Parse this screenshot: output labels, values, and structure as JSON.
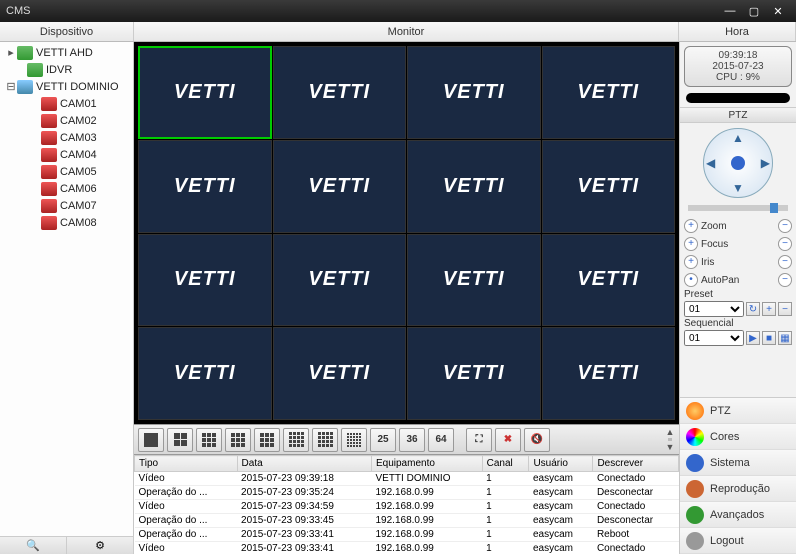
{
  "app_title": "CMS",
  "header": {
    "device": "Dispositivo",
    "monitor": "Monitor",
    "time": "Hora"
  },
  "clock": {
    "time": "09:39:18",
    "date": "2015-07-23",
    "cpu": "CPU : 9%"
  },
  "tree": {
    "root": "VETTI AHD",
    "idvr": "IDVR",
    "domain": "VETTI DOMINIO",
    "cams": [
      "CAM01",
      "CAM02",
      "CAM03",
      "CAM04",
      "CAM05",
      "CAM06",
      "CAM07",
      "CAM08"
    ]
  },
  "grid_brand": "VETTI",
  "view_buttons_numeric": [
    "25",
    "36",
    "64"
  ],
  "ptz": {
    "title": "PTZ",
    "zoom": "Zoom",
    "focus": "Focus",
    "iris": "Iris",
    "autopan": "AutoPan",
    "preset_label": "Preset",
    "sequential_label": "Sequencial",
    "preset_value": "01",
    "sequential_value": "01"
  },
  "side_tabs": {
    "ptz": "PTZ",
    "cores": "Cores",
    "sistema": "Sistema",
    "reproducao": "Reprodução",
    "avancados": "Avançados",
    "logout": "Logout"
  },
  "log": {
    "headers": {
      "tipo": "Tipo",
      "data": "Data",
      "equipamento": "Equipamento",
      "canal": "Canal",
      "usuario": "Usuário",
      "descrever": "Descrever"
    },
    "rows": [
      {
        "tipo": "Vídeo",
        "data": "2015-07-23 09:39:18",
        "equip": "VETTI DOMINIO",
        "canal": "1",
        "user": "easycam",
        "desc": "Conectado"
      },
      {
        "tipo": "Operação do ...",
        "data": "2015-07-23 09:35:24",
        "equip": "192.168.0.99",
        "canal": "1",
        "user": "easycam",
        "desc": "Desconectar"
      },
      {
        "tipo": "Vídeo",
        "data": "2015-07-23 09:34:59",
        "equip": "192.168.0.99",
        "canal": "1",
        "user": "easycam",
        "desc": "Conectado"
      },
      {
        "tipo": "Operação do ...",
        "data": "2015-07-23 09:33:45",
        "equip": "192.168.0.99",
        "canal": "1",
        "user": "easycam",
        "desc": "Desconectar"
      },
      {
        "tipo": "Operação do ...",
        "data": "2015-07-23 09:33:41",
        "equip": "192.168.0.99",
        "canal": "1",
        "user": "easycam",
        "desc": "Reboot"
      },
      {
        "tipo": "Vídeo",
        "data": "2015-07-23 09:33:41",
        "equip": "192.168.0.99",
        "canal": "1",
        "user": "easycam",
        "desc": "Conectado"
      }
    ]
  }
}
